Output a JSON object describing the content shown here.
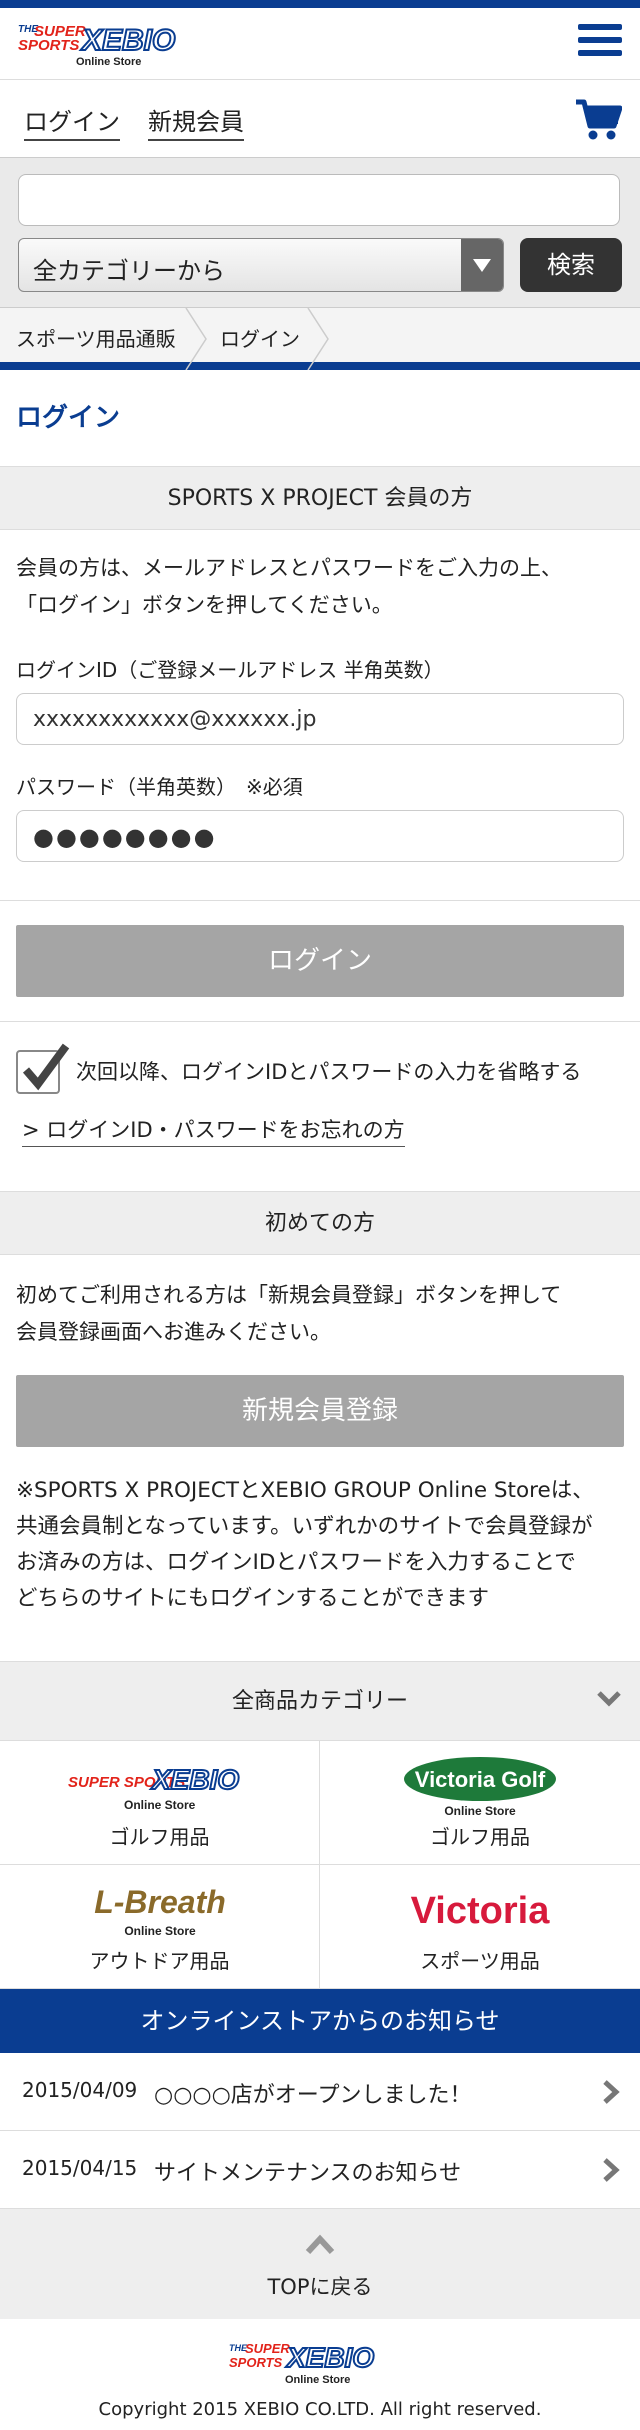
{
  "header": {
    "logo_line1": "THE SUPER SPORTS",
    "logo_main": "XEBIO",
    "logo_sub": "Online Store"
  },
  "account": {
    "login": "ログイン",
    "register": "新規会員"
  },
  "search": {
    "input_value": "",
    "category_selected": "全カテゴリーから",
    "button": "検索"
  },
  "breadcrumb": [
    "スポーツ用品通販",
    "ログイン"
  ],
  "page_title": "ログイン",
  "member": {
    "heading": "SPORTS X PROJECT 会員の方",
    "desc_line1": "会員の方は、メールアドレスとパスワードをご入力の上、",
    "desc_line2": "「ログイン」ボタンを押してください。",
    "id_label": "ログインID（ご登録メールアドレス 半角英数）",
    "id_value": "xxxxxxxxxxxx@xxxxxx.jp",
    "pw_label": "パスワード（半角英数）　※必須",
    "pw_value": "●●●●●●●●",
    "login_button": "ログイン",
    "remember_label": "次回以降、ログインIDとパスワードの入力を省略する",
    "forgot_link": "> ログインID・パスワードをお忘れの方"
  },
  "new_user": {
    "heading": "初めての方",
    "desc_line1": "初めてご利用される方は「新規会員登録」ボタンを押して",
    "desc_line2": "会員登録画面へお進みください。",
    "register_button": "新規会員登録",
    "note_line1": "※SPORTS X PROJECTとXEBIO GROUP Online Storeは、",
    "note_line2": "共通会員制となっています。いずれかのサイトで会員登録が",
    "note_line3": "お済みの方は、ログインIDとパスワードを入力することで",
    "note_line4": "どちらのサイトにもログインすることができます"
  },
  "categories": {
    "heading": "全商品カテゴリー",
    "stores": [
      {
        "logo": "XEBIO",
        "logo_sub": "Online Store",
        "label": "ゴルフ用品"
      },
      {
        "logo": "Victoria Golf",
        "logo_sub": "Online Store",
        "label": "ゴルフ用品"
      },
      {
        "logo": "L-Breath",
        "logo_sub": "Online Store",
        "label": "アウトドア用品"
      },
      {
        "logo": "Victoria",
        "logo_sub": "",
        "label": "スポーツ用品"
      }
    ]
  },
  "news": {
    "heading": "オンラインストアからのお知らせ",
    "items": [
      {
        "date": "2015/04/09",
        "text": "○○○○店がオープンしました！"
      },
      {
        "date": "2015/04/15",
        "text": "サイトメンテナンスのお知らせ"
      }
    ]
  },
  "to_top": "TOPに戻る",
  "footer": {
    "copyright": "Copyright 2015 XEBIO CO.LTD. All right reserved."
  },
  "colors": {
    "brand_blue": "#0a3d91",
    "logo_red": "#e2231a",
    "victoria_red": "#d71a3c",
    "golf_green": "#1e7a3a",
    "lbreath_brown": "#8a6a2a"
  }
}
